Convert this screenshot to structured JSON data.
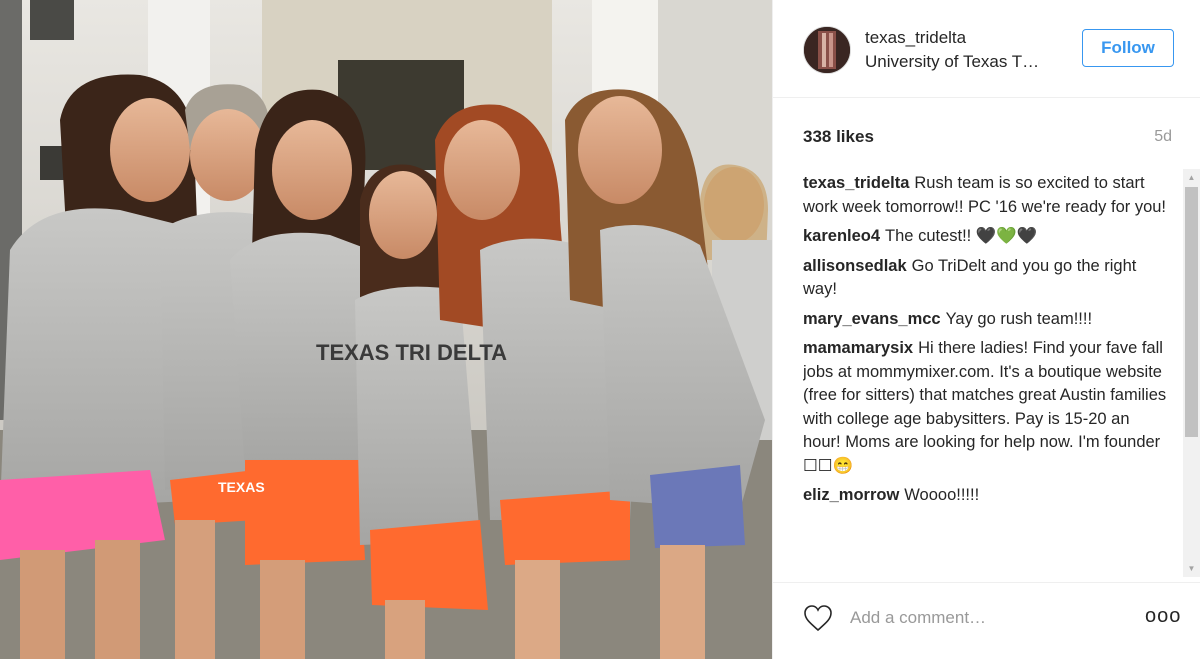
{
  "post": {
    "username": "texas_tridelta",
    "location": "University of Texas T…",
    "follow_label": "Follow",
    "likes": "338 likes",
    "age": "5d",
    "add_comment_placeholder": "Add a comment…",
    "more_label": "ooo"
  },
  "comments": [
    {
      "user": "texas_tridelta",
      "text": "Rush team is so excited to start work week tomorrow!! PC '16 we're ready for you!"
    },
    {
      "user": "karenleo4",
      "text": "The cutest!! 🖤💚🖤"
    },
    {
      "user": "allisonsedlak",
      "text": "Go TriDelt and you go the right way!"
    },
    {
      "user": "mary_evans_mcc",
      "text": "Yay go rush team!!!!"
    },
    {
      "user": "mamamarysix",
      "text": "Hi there ladies! Find your fave fall jobs at mommymixer.com. It's a boutique website (free for sitters) that matches great Austin families with college age babysitters. Pay is 15-20 an hour! Moms are looking for help now. I'm founder ☐☐😁"
    },
    {
      "user": "eliz_morrow",
      "text": "Woooo!!!!!"
    }
  ],
  "photo": {
    "shirt_text": "TEXAS TRI DELTA",
    "shorts_text": "TEXAS"
  },
  "colors": {
    "accent_blue": "#3897f0",
    "shorts_orange": "#ff6a2f",
    "shorts_pink": "#ff5fa8",
    "shorts_blue": "#6b78b8",
    "shirt_gray": "#b9b9b7"
  }
}
